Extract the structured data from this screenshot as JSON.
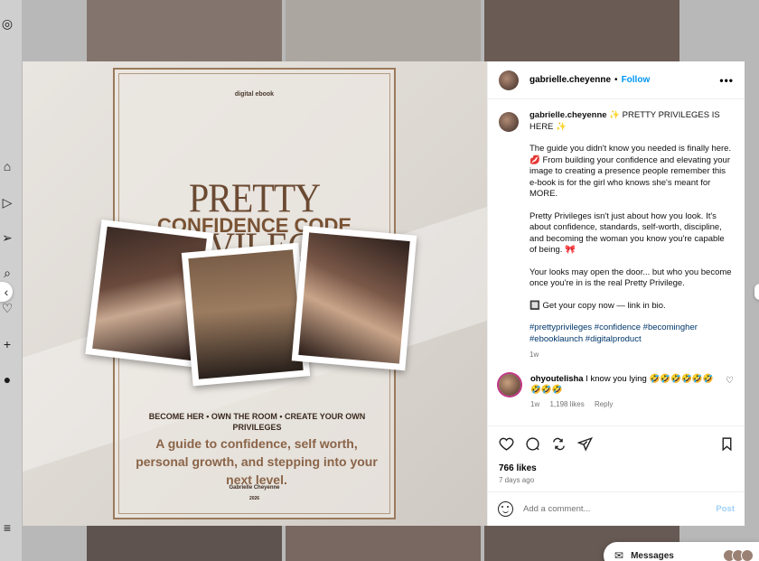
{
  "post": {
    "username": "gabrielle.cheyenne",
    "follow_label": "Follow",
    "header_dot": "•",
    "more_label": "•••",
    "caption": {
      "username": "gabrielle.cheyenne",
      "title": "✨ PRETTY PRIVILEGES IS HERE ✨",
      "p1": "The guide you didn't know you needed is finally here. 💋 From building your confidence and elevating your image to creating a presence people remember this e-book is for the girl who knows she's meant for MORE.",
      "p2": "Pretty Privileges isn't just about how you look. It's about confidence, standards, self-worth, discipline, and becoming the woman you know you're capable of being. 🎀",
      "p3": "Your looks may open the door... but who you become once you're in is the real Pretty Privilege.",
      "p4": "🔲 Get your copy now — link in bio.",
      "hashtags": "#prettyprivileges #confidence #becomingher #ebooklaunch #digitalproduct",
      "time": "1w"
    },
    "comment": {
      "username": "ohyoutelisha",
      "text": "I know you lying 🤣🤣🤣🤣🤣🤣🤣🤣🤣",
      "time": "1w",
      "likes": "1,198 likes",
      "reply": "Reply"
    },
    "likes": "766 likes",
    "posted_ago": "7 days ago",
    "add_comment_placeholder": "Add a comment...",
    "post_button": "Post"
  },
  "ebook": {
    "tag": "digital ebook",
    "title": "PRETTY PRIVILEGES",
    "subtitle": "CONFIDENCE CODE",
    "tagline": "BECOME HER • OWN THE ROOM • CREATE YOUR OWN PRIVILEGES",
    "description": "A guide to confidence, self worth, personal growth, and stepping into your next level.",
    "author": "Gabrielle Cheyenne",
    "year": "2026"
  },
  "messages": {
    "label": "Messages"
  },
  "colors": {
    "link": "#0095f6",
    "hashtag": "#00376b",
    "muted": "#737373",
    "ebook_brown": "#6b4a32"
  }
}
